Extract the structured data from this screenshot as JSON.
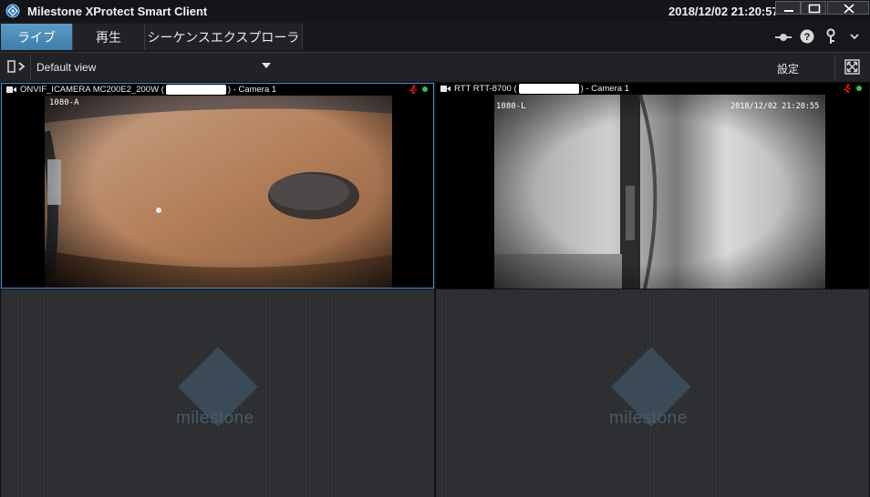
{
  "window": {
    "title": "Milestone XProtect Smart Client",
    "datetime": "2018/12/02 21:20:57"
  },
  "tabs": [
    {
      "label": "ライブ",
      "active": true
    },
    {
      "label": "再生",
      "active": false
    },
    {
      "label": "シーケンスエクスプローラ",
      "active": false
    }
  ],
  "toolbar": {
    "view_name": "Default view",
    "settings_label": "設定"
  },
  "cameras": [
    {
      "name_prefix": "ONVIF_ICAMERA MC200E2_200W (",
      "name_suffix": ") - Camera 1",
      "osd_text": "1080-A",
      "selected": true
    },
    {
      "name_prefix": "RTT RTT-8700 (",
      "name_suffix": ") - Camera 1",
      "osd_text": "1080-L",
      "osd_timestamp": "2018/12/02 21:20:55",
      "selected": false
    }
  ],
  "placeholder_brand": "milestone",
  "colors": {
    "accent": "#4a8fd1",
    "active_tab": "#4f8dba",
    "status_online": "#26c74a",
    "motion_indicator": "#e02020"
  }
}
